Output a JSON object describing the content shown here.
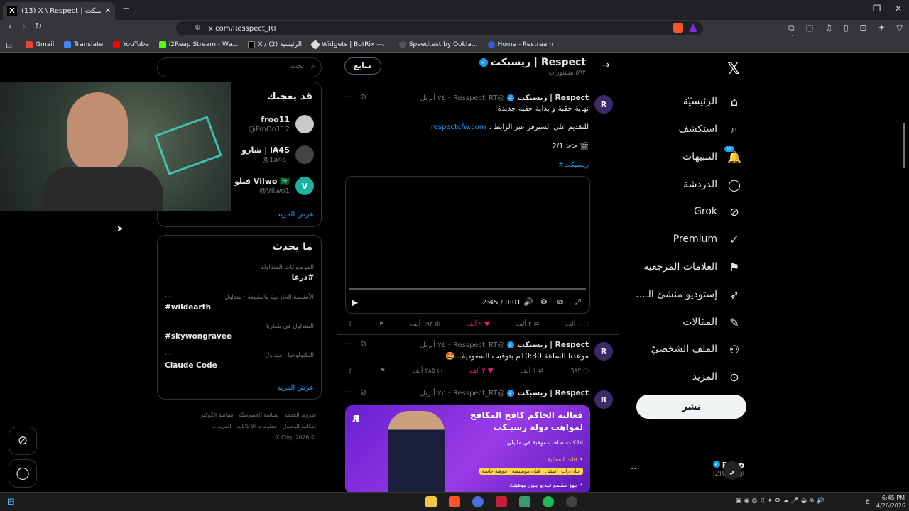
{
  "browser": {
    "tab_title": "(13) X \\ Respect | ريسبكت (@Res...",
    "tab_favicon": "X",
    "new_tab": "+",
    "url": "x.com/Resspect_RT",
    "bookmarks": [
      "Gmail",
      "Translate",
      "YouTube",
      "i2Reap Stream - Wa...",
      "X / الرئيسية (2)",
      "Widgets | BotRix —...",
      "Speedtest by Ookla...",
      "Home - Restream"
    ]
  },
  "nav": {
    "items": [
      {
        "label": "الرئيسيّة",
        "icon": "home-icon",
        "glyph": "⌂"
      },
      {
        "label": "استكشف",
        "icon": "search-icon",
        "glyph": "⌕"
      },
      {
        "label": "التنبيهات",
        "icon": "bell-icon",
        "glyph": "🔔",
        "badge": "١٣"
      },
      {
        "label": "الدردشة",
        "icon": "chat-icon",
        "glyph": "◯"
      },
      {
        "label": "Grok",
        "icon": "grok-icon",
        "glyph": "⊘"
      },
      {
        "label": "Premium",
        "icon": "premium-icon",
        "glyph": "✓"
      },
      {
        "label": "العلامات المرجعية",
        "icon": "bookmark-icon",
        "glyph": "⚑"
      },
      {
        "label": "إستوديو منشئ الـ...",
        "icon": "rocket-icon",
        "glyph": "➶"
      },
      {
        "label": "المقالات",
        "icon": "article-icon",
        "glyph": "✎"
      },
      {
        "label": "الملف الشخصيّ",
        "icon": "profile-icon",
        "glyph": "⚇"
      },
      {
        "label": "المزيد",
        "icon": "more-icon",
        "glyph": "⊙"
      }
    ],
    "post_label": "نشر",
    "account": {
      "name": "Reap",
      "handle": "@i2Reap",
      "more": "..."
    }
  },
  "profile_header": {
    "name": "Respect | ريسبكت",
    "posts_count": "٥٩٢ منشورات",
    "follow_label": "متابع"
  },
  "tweets": [
    {
      "name": "Respect | ريسبكت",
      "handle": "@Resspect_RT",
      "date": "٢٤ أبريل",
      "lines": [
        "نهاية حقبة و بداية حقبه جديدة!"
      ],
      "link_prefix": "للتقديم على السيرفر عبر الرابط :",
      "link": "respectcfw.com",
      "thread": "2/1 >> 🎬",
      "hashtag": "#ريسبكت",
      "video_time": "2:45 / 0:01",
      "replies": "١ ألف",
      "retweets": "٢ ألف",
      "likes": "٩ آلف",
      "views": "٦٩٣ ألف"
    },
    {
      "name": "Respect | ريسبكت",
      "handle": "@Resspect_RT",
      "date": "٢٤ أبريل",
      "lines": [
        "موعدنا الساعة 10:30م بتوقيت السعودية...🤩"
      ],
      "replies": "٦٨٢",
      "retweets": "١ ألف",
      "likes": "٢ ألف",
      "views": "٢٨٥ ألف"
    },
    {
      "name": "Respect | ريسبكت",
      "handle": "@Resspect_RT",
      "date": "٢٢ أبريل",
      "banner_title": "فعالية الحاكم كافح المكافح لمواهب دولة رسبـكت",
      "banner_sub": "اذا كنت صاحب موهبة في ما يلي:",
      "banner_item1": "• فئات الفعالية",
      "banner_item2": "فنان راب - تمثيل - فنان موسيقية - موهبة خاصة",
      "banner_item3": "• جهز مقطع فيديو يبين موهبتك"
    }
  ],
  "search": {
    "placeholder": "بحث"
  },
  "who_to_follow": {
    "title": "قد يعجبك",
    "users": [
      {
        "name": "froo11",
        "handle": "@FroOo112"
      },
      {
        "name": "iA4S | شارو",
        "handle": "@1a4s_"
      },
      {
        "name": "Vilwo 🇸🇦 فيلو",
        "handle": "@Vilwo1"
      }
    ],
    "show_more": "عرض المزيد"
  },
  "trends": {
    "title": "ما يحدث",
    "items": [
      {
        "category": "الموضوعات المتداولة",
        "name": "#درعا"
      },
      {
        "category": "الأنشطة الخارجية والطبيعة · متداول",
        "name": "#wildearth"
      },
      {
        "category": "المتداول في بلغاريا",
        "name": "#skywongravee"
      },
      {
        "category": "التكنولوجيا · متداول",
        "name": "Claude Code"
      }
    ],
    "more_icon": "...",
    "show_more": "عرض المزيد"
  },
  "footer": {
    "line1": [
      "شروط الخدمة",
      "سياسة الخصوصيّة",
      "سياسة الكوكيز"
    ],
    "line2": [
      "إمكانية الوصول",
      "معلومات الإعلانات",
      "المزيد ..."
    ],
    "copyright": "© 2026 X Corp."
  },
  "taskbar": {
    "time": "6:45 PM",
    "date": "4/26/2026",
    "lang": "ع"
  },
  "colors": {
    "accent": "#1d9bf0",
    "like": "#f91880",
    "bg": "#000000",
    "border": "#2f3336"
  }
}
